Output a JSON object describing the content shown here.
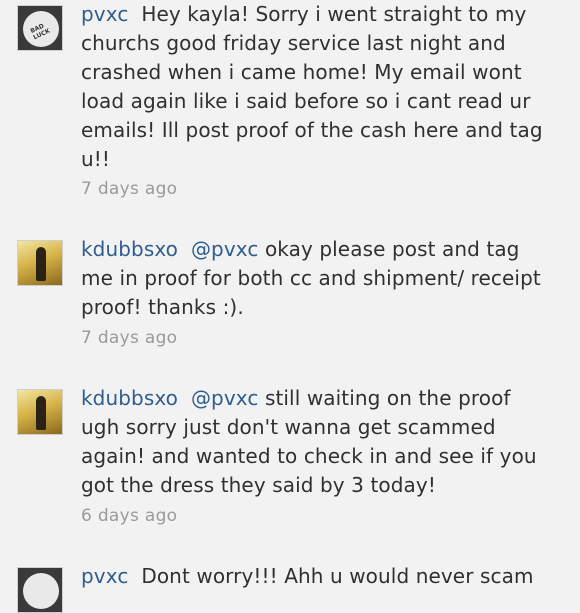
{
  "comments": [
    {
      "username": "pvxc",
      "text": "Hey kayla! Sorry i went straight to my churchs good friday service last night and crashed when i came home! My email wont load again like i said before so i cant read ur emails! Ill post proof of the cash here and tag u!!",
      "mention": "",
      "time": "7 days ago",
      "avatar": "bad-luck-logo-avatar",
      "avatar_text": "BAD LUCK"
    },
    {
      "username": "kdubbsxo",
      "mention": "@pvxc",
      "text": "okay please post and tag me in proof for both cc and shipment/ receipt proof! thanks :).",
      "time": "7 days ago",
      "avatar": "dress-photo-avatar"
    },
    {
      "username": "kdubbsxo",
      "mention": "@pvxc",
      "text": "still waiting on the proof ugh sorry just don't wanna get scammed again! and wanted to check in and see if you got the dress they said by 3 today!",
      "time": "6 days ago",
      "avatar": "dress-photo-avatar"
    },
    {
      "username": "pvxc",
      "mention": "",
      "text": "Dont worry!!! Ahh u would never scam",
      "time": "",
      "avatar": "bad-luck-logo-avatar"
    }
  ]
}
